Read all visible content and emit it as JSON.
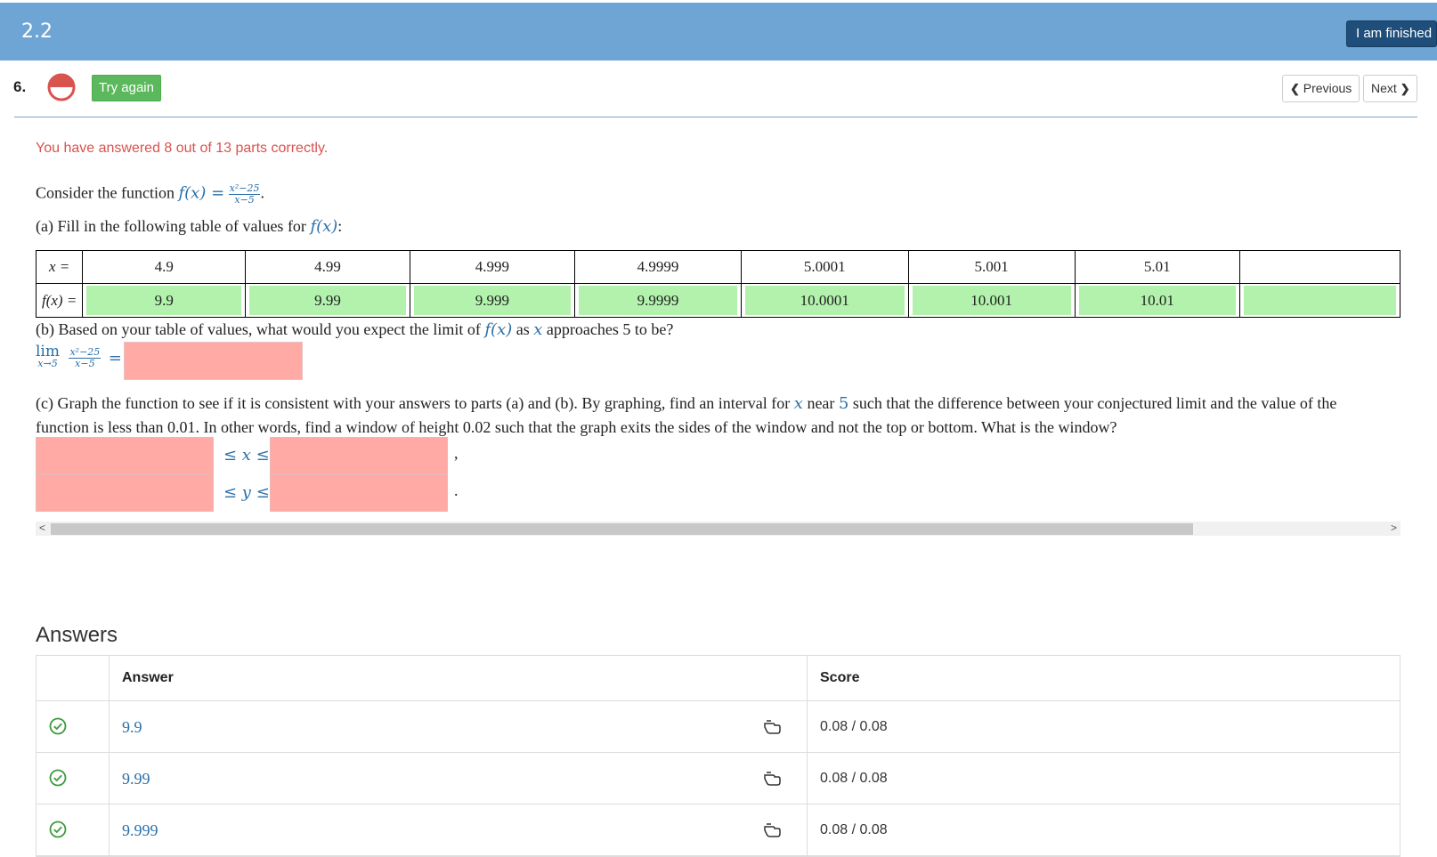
{
  "header": {
    "title": "2.2",
    "finish_label": "I am finished"
  },
  "question": {
    "number": "6.",
    "try_again_label": "Try again",
    "prev_label": "Previous",
    "next_label": "Next",
    "score_message": "You have answered 8 out of 13 parts correctly."
  },
  "problem": {
    "intro": "Consider the function",
    "func_lhs": "f(x) =",
    "frac_num": "x²−25",
    "frac_den": "x−5",
    "part_a_text": "(a) Fill in the following table of values for",
    "part_a_func": "f(x)",
    "table": {
      "x_label": "x =",
      "fx_label": "f(x) =",
      "x_values": [
        "4.9",
        "4.99",
        "4.999",
        "4.9999",
        "5.0001",
        "5.001",
        "5.01"
      ],
      "fx_values": [
        "9.9",
        "9.99",
        "9.999",
        "9.9999",
        "10.0001",
        "10.001",
        "10.01"
      ]
    },
    "part_b_pre": "(b) Based on your table of values, what would you expect the limit of",
    "part_b_func": "f(x)",
    "part_b_mid": "as",
    "part_b_var": "x",
    "part_b_post": "approaches 5 to be?",
    "lim_word": "lim",
    "lim_sub": "x→5",
    "lim_eq": "=",
    "part_c_pre": "(c) Graph the function to see if it is consistent with your answers to parts (a) and (b). By graphing, find an interval for",
    "part_c_var": "x",
    "part_c_near": "near",
    "part_c_five": "5",
    "part_c_post": "such that the difference between your conjectured limit and the value of the function is less than 0.01. In other words, find a window of height 0.02 such that the graph exits the sides of the window and not the top or bottom. What is the window?",
    "leq_x": "≤ x ≤",
    "leq_y": "≤ y ≤",
    "comma": ",",
    "period": "."
  },
  "answers": {
    "heading": "Answers",
    "col_answer": "Answer",
    "col_score": "Score",
    "rows": [
      {
        "value": "9.9",
        "score": "0.08 / 0.08"
      },
      {
        "value": "9.99",
        "score": "0.08 / 0.08"
      },
      {
        "value": "9.999",
        "score": "0.08 / 0.08"
      }
    ]
  },
  "colors": {
    "header": "#6fa5d5",
    "correct": "#b2f2ad",
    "incorrect": "#ffaaa5",
    "error_text": "#d9534f",
    "math": "#2a6fa8"
  }
}
